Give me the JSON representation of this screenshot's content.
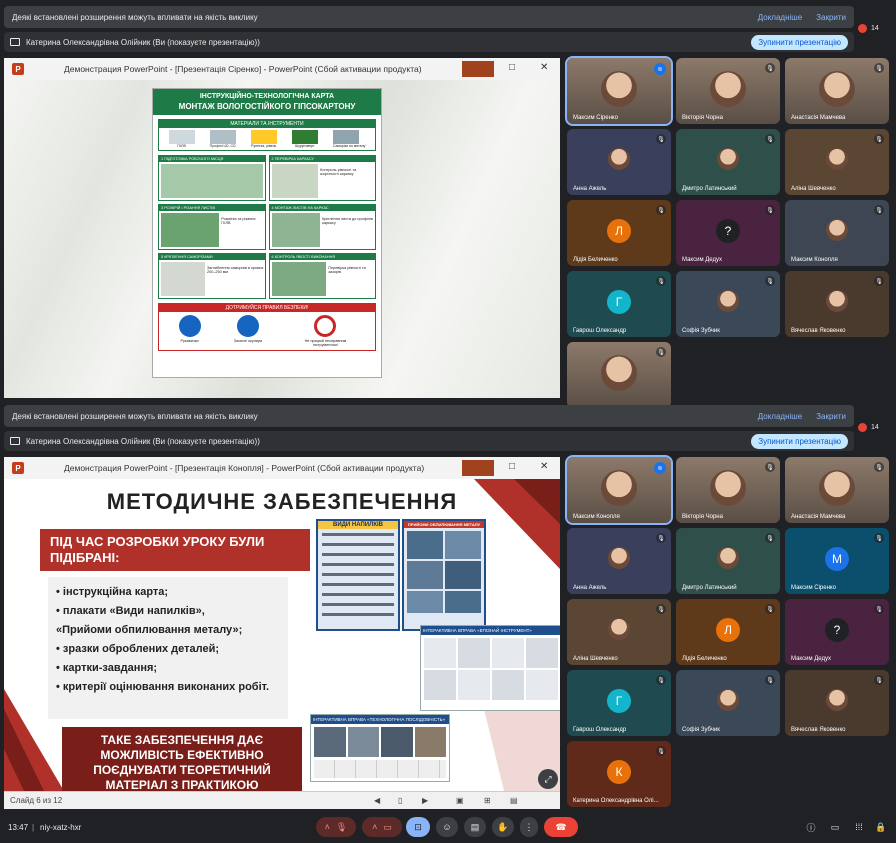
{
  "top": {
    "warning": "Деякі встановлені розширення можуть впливати на якість виклику",
    "details": "Докладніше",
    "close": "Закрити",
    "presenting": "Катерина Олександрівна Олійник (Ви (показуєте презентацію))",
    "stop": "Зупинити презентацію",
    "people_count": "14",
    "ppt_title": "Демонстрация PowerPoint - [Презентація Сіренко] - PowerPoint (Сбой активации продукта)",
    "slide": {
      "title1": "ІНСТРУКЦІЙНО-ТЕХНОЛОГІЧНА КАРТА",
      "title2": "МОНТАЖ ВОЛОГОСТІЙКОГО ГІПСОКАРТОНУ",
      "materials_head": "МАТЕРІАЛИ ТА ІНСТРУМЕНТИ",
      "materials": [
        "ГКЛВ",
        "Профілі UD, CD",
        "Рулетка, рівень",
        "Шуруповерт",
        "Саморізи по металу"
      ],
      "steps": [
        {
          "num": "1",
          "title": "ПІДГОТОВКА РОБОЧОГО МІСЦЯ"
        },
        {
          "num": "2",
          "title": "ПЕРЕВІРКА КАРКАСУ",
          "note": "Контроль рівності та жорсткості каркасу"
        },
        {
          "num": "3",
          "title": "РОЗКРІЙ І РІЗАННЯ ЛИСТІВ",
          "note": "Розмітка та різання ГКЛВ"
        },
        {
          "num": "4",
          "title": "МОНТАЖ ЛИСТІВ НА КАРКАС",
          "note": "Кріплення листа до профілів каркасу"
        },
        {
          "num": "5",
          "title": "КРІПЛЕННЯ САМОРІЗАМИ",
          "note": "Заглиблення саморізів в кромок 200–250 мм"
        },
        {
          "num": "6",
          "title": "КОНТРОЛЬ ЯКОСТІ ВИКОНАННЯ",
          "note": "Перевірка рівності та зазорів"
        }
      ],
      "safety_head": "ДОТРИМУЙСЯ ПРАВИЛ БЕЗПЕКИ!",
      "safety": [
        "Рукавички",
        "Захисні окуляри",
        "Не працюй несправним інструментом!"
      ]
    },
    "participants": [
      {
        "name": "Максим Сіренко",
        "kind": "video",
        "active": true,
        "speaking": true
      },
      {
        "name": "Вікторія Чорна",
        "kind": "video"
      },
      {
        "name": "Анастасія Мамчева",
        "kind": "video"
      },
      {
        "name": "Анна Ажель",
        "kind": "photo",
        "bg": "#3a3f5c"
      },
      {
        "name": "Дмитро Латинський",
        "kind": "photo",
        "bg": "#2f4f4a"
      },
      {
        "name": "Аліна Шевченко",
        "kind": "photo",
        "bg": "#5a4632"
      },
      {
        "name": "Лідія Беличенко",
        "kind": "letter",
        "letter": "Л",
        "bg": "#5f3a1a",
        "color": "#e8710a"
      },
      {
        "name": "Максим Дедух",
        "kind": "letter",
        "letter": "?",
        "bg": "#4a2340",
        "color": "#202124"
      },
      {
        "name": "Максим Конопля",
        "kind": "photo",
        "bg": "#3d4652"
      },
      {
        "name": "Гаврош Олександр",
        "kind": "letter",
        "letter": "Г",
        "bg": "#1f4a4f",
        "color": "#12b5cb"
      },
      {
        "name": "Софія Зубчик",
        "kind": "photo",
        "bg": "#3a4858"
      },
      {
        "name": "Вячеслав Яковенко",
        "kind": "photo",
        "bg": "#4a3a2e"
      },
      {
        "name": "",
        "kind": "video"
      }
    ]
  },
  "bottom": {
    "warning": "Деякі встановлені розширення можуть впливати на якість виклику",
    "details": "Докладніше",
    "close": "Закрити",
    "presenting": "Катерина Олександрівна Олійник (Ви (показуєте презентацію))",
    "stop": "Зупинити презентацію",
    "people_count": "14",
    "ppt_title": "Демонстрация PowerPoint - [Презентація Конопля] - PowerPoint (Сбой активации продукта)",
    "slide": {
      "title": "МЕТОДИЧНЕ ЗАБЕЗПЕЧЕННЯ",
      "banner": "ПІД ЧАС РОЗРОБКИ УРОКУ БУЛИ ПІДІБРАНІ:",
      "items": [
        "•   інструкційна карта;",
        "• плакати «Види напилків»,",
        "«Прийоми обпилювання металу»;",
        "• зразки оброблених деталей;",
        "• картки-завдання;",
        "• критерії оцінювання виконаних робіт."
      ],
      "conclusion": "ТАКЕ ЗАБЕЗПЕЧЕННЯ ДАЄ МОЖЛИВІСТЬ ЕФЕКТИВНО ПОЄДНУВАТИ ТЕОРЕТИЧНИЙ МАТЕРІАЛ З ПРАКТИКОЮ",
      "poster1": "ВИДИ НАПИЛКІВ",
      "poster2": "ПРИЙОМИ ОБПИЛЮВАННЯ МЕТАЛУ",
      "card1": "ІНТЕРАКТИВНА ВПРАВА «ВПІЗНАЙ ІНСТРУМЕНТ»",
      "card2": "ІНТЕРАКТИВНА ВПРАВА «ТЕХНОЛОГІЧНА ПОСЛІДОВНІСТЬ»"
    },
    "status": "Слайд 6 из 12",
    "participants": [
      {
        "name": "Максим Конопля",
        "kind": "video",
        "active": true,
        "speaking": true
      },
      {
        "name": "Вікторія Чорна",
        "kind": "video"
      },
      {
        "name": "Анастасія Мамчева",
        "kind": "video"
      },
      {
        "name": "Анна Ажель",
        "kind": "photo",
        "bg": "#3a3f5c"
      },
      {
        "name": "Дмитро Латинський",
        "kind": "photo",
        "bg": "#2f4f4a"
      },
      {
        "name": "Максим Сіренко",
        "kind": "letter",
        "letter": "М",
        "bg": "#0b4f6c",
        "color": "#1a73e8"
      },
      {
        "name": "Аліна Шевченко",
        "kind": "photo",
        "bg": "#5a4632"
      },
      {
        "name": "Лідія Беличенко",
        "kind": "letter",
        "letter": "Л",
        "bg": "#5f3a1a",
        "color": "#e8710a"
      },
      {
        "name": "Максим Дедух",
        "kind": "letter",
        "letter": "?",
        "bg": "#4a2340",
        "color": "#202124"
      },
      {
        "name": "Гаврош Олександр",
        "kind": "letter",
        "letter": "Г",
        "bg": "#1f4a4f",
        "color": "#12b5cb"
      },
      {
        "name": "Софія Зубчик",
        "kind": "photo",
        "bg": "#3a4858"
      },
      {
        "name": "Вячеслав Яковенко",
        "kind": "photo",
        "bg": "#4a3a2e"
      },
      {
        "name": "Катерина Олександрівна Олі...",
        "kind": "letter",
        "letter": "К",
        "bg": "#5f2a1a",
        "color": "#e8710a"
      }
    ]
  },
  "toolbar": {
    "time": "13:47",
    "separator": "|",
    "meeting_code": "niy-xatz-hxr"
  },
  "colors": {
    "accent": "#8ab4f8",
    "hangup": "#ea4335",
    "slide_red": "#b0302a",
    "infographic_green": "#1e7a46"
  }
}
